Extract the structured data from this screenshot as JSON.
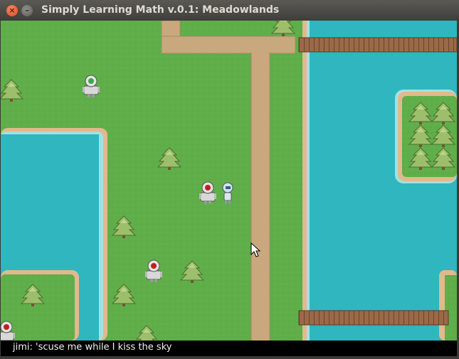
{
  "window": {
    "title": "Simply Learning Math v.0.1: Meadowlands",
    "close_glyph": "×",
    "minimize_glyph": "–"
  },
  "chat": {
    "line": "jimi: 'scuse me while I kiss the sky"
  },
  "colors": {
    "grass": "#5fae4a",
    "water": "#30b6be",
    "sand": "#e2b98c",
    "path": "#c9a87e",
    "bridge": "#9a6a48",
    "chat_bg": "#000000"
  },
  "icons": {
    "close": "close-icon",
    "minimize": "minimize-icon",
    "cursor": "mouse-pointer-icon",
    "tree": "pine-tree-icon",
    "npc": "robot-npc-icon",
    "player": "player-character-icon"
  }
}
